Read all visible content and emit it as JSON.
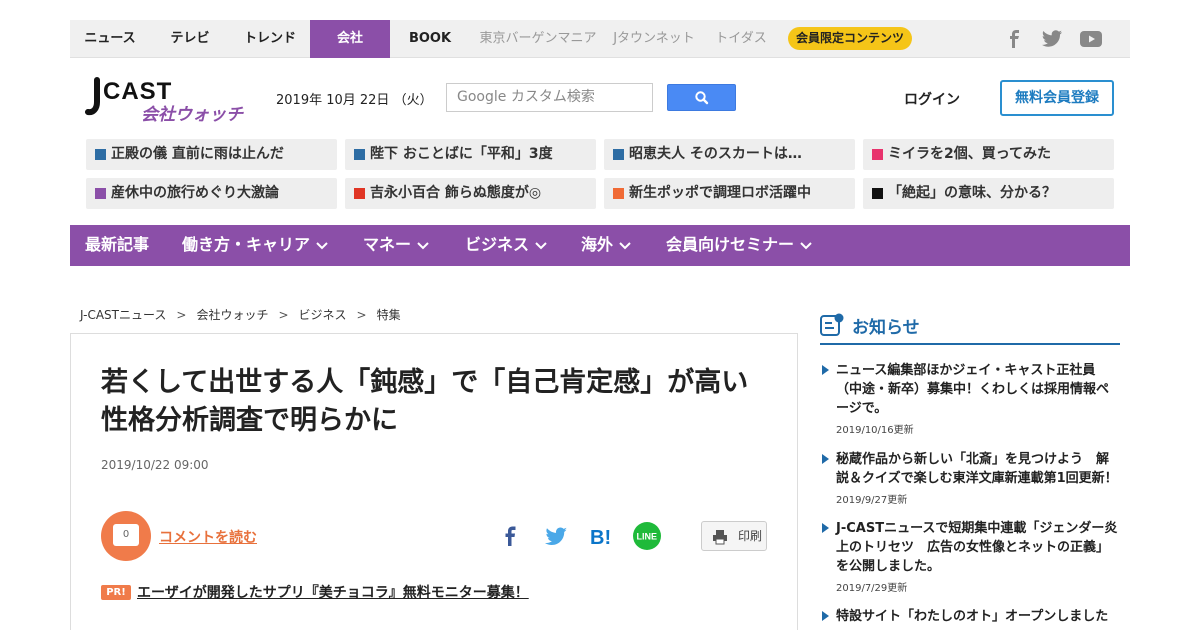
{
  "topnav": {
    "items": [
      {
        "label": "ニュース"
      },
      {
        "label": "テレビ"
      },
      {
        "label": "トレンド"
      },
      {
        "label": "会社"
      },
      {
        "label": "BOOK"
      },
      {
        "label": "東京バーゲンマニア"
      },
      {
        "label": "Jタウンネット"
      },
      {
        "label": "トイダス"
      }
    ],
    "members_label": "会員限定コンテンツ",
    "social_icons": [
      "facebook-icon",
      "twitter-icon",
      "youtube-icon"
    ]
  },
  "header": {
    "logo_text": "J-CAST",
    "logo_sub": "会社ウォッチ",
    "date": "2019年 10月 22日 （火）",
    "search_placeholder": "Google カスタム検索",
    "login_label": "ログイン",
    "signup_label": "無料会員登録"
  },
  "trending": [
    {
      "label": "正殿の儀 直前に雨は止んだ",
      "color": "#2e6da4"
    },
    {
      "label": "陛下 おことばに「平和」3度",
      "color": "#2e6da4"
    },
    {
      "label": "昭恵夫人 そのスカートは…",
      "color": "#2e6da4"
    },
    {
      "label": "ミイラを2個、買ってみた",
      "color": "#e8336d"
    },
    {
      "label": "産休中の旅行めぐり大激論",
      "color": "#8b4fa8"
    },
    {
      "label": "吉永小百合 飾らぬ態度が◎",
      "color": "#e03524"
    },
    {
      "label": "新生ポッポで調理ロボ活躍中",
      "color": "#f06a35"
    },
    {
      "label": "「絶起」の意味、分かる？",
      "color": "#111111"
    }
  ],
  "catnav": [
    {
      "label": "最新記事"
    },
    {
      "label": "働き方・キャリア"
    },
    {
      "label": "マネー"
    },
    {
      "label": "ビジネス"
    },
    {
      "label": "海外"
    },
    {
      "label": "会員向けセミナー"
    }
  ],
  "breadcrumb": [
    "J-CASTニュース",
    "会社ウォッチ",
    "ビジネス",
    "特集"
  ],
  "breadcrumb_sep": ">",
  "article": {
    "title": "若くして出世する人「鈍感」で「自己肯定感」が高い　性格分析調査で明らかに",
    "date": "2019/10/22 09:00",
    "comment_count": "0",
    "comment_link": "コメントを読む",
    "print_label": "印刷",
    "share_icons": [
      "facebook-icon",
      "twitter-icon",
      "hatena-bookmark-icon",
      "line-icon"
    ],
    "pr_badge": "PR!",
    "pr_text": "エーザイが開発したサプリ『美チョコラ』無料モニター募集！"
  },
  "sidebar": {
    "title": "お知らせ",
    "items": [
      {
        "text": "ニュース編集部ほかジェイ・キャスト正社員（中途・新卒）募集中！くわしくは採用情報ページで。",
        "updated": "2019/10/16更新"
      },
      {
        "text": "秘蔵作品から新しい「北斎」を見つけよう　解説＆クイズで楽しむ東洋文庫新連載第1回更新！",
        "updated": "2019/9/27更新"
      },
      {
        "text": "J-CASTニュースで短期集中連載「ジェンダー炎上のトリセツ　広告の女性像とネットの正義」を公開しました。",
        "updated": "2019/7/29更新"
      },
      {
        "text": "特設サイト「わたしのオト」オープンしました",
        "updated": ""
      }
    ]
  },
  "colors": {
    "brand_purple": "#8b4fa8",
    "accent_orange": "#f07b4a",
    "link_blue": "#1f6aa8",
    "members_yellow": "#f5c518"
  }
}
